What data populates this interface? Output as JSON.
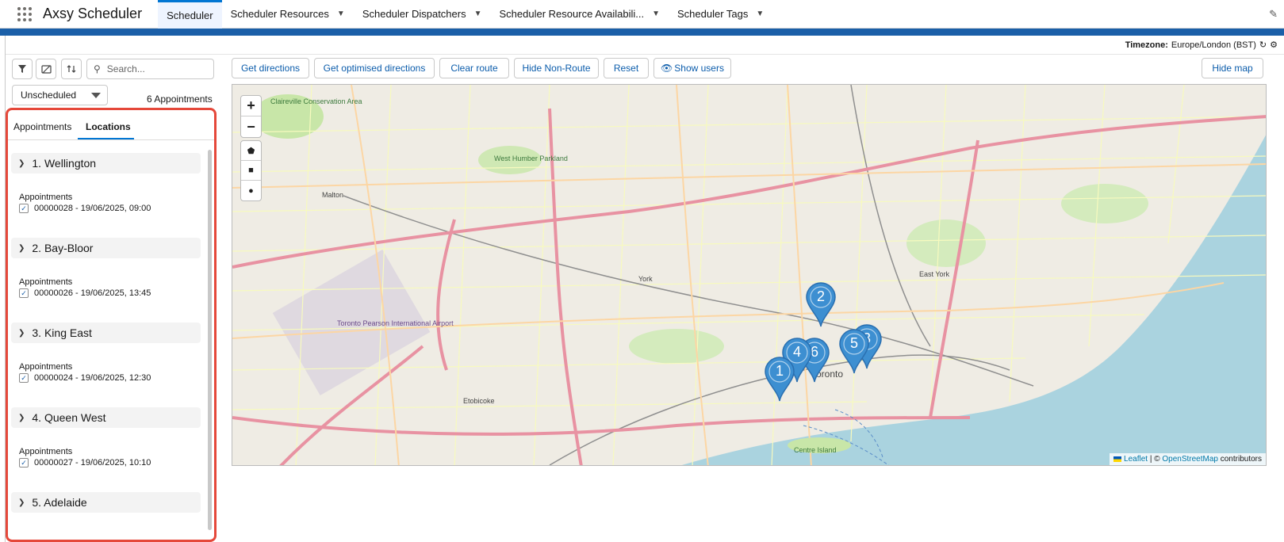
{
  "nav": {
    "app_name": "Axsy Scheduler",
    "tabs": [
      {
        "label": "Scheduler",
        "has_menu": false
      },
      {
        "label": "Scheduler Resources",
        "has_menu": true
      },
      {
        "label": "Scheduler Dispatchers",
        "has_menu": true
      },
      {
        "label": "Scheduler Resource Availabili...",
        "has_menu": true
      },
      {
        "label": "Scheduler Tags",
        "has_menu": true
      }
    ]
  },
  "timezone": {
    "label": "Timezone:",
    "value": "Europe/London (BST)"
  },
  "left": {
    "search_placeholder": "Search...",
    "filter_value": "Unscheduled",
    "count": "6 Appointments",
    "tabs": [
      "Appointments",
      "Locations"
    ],
    "locations": [
      {
        "name": "1. Wellington",
        "appts_label": "Appointments",
        "appt": "00000028 - 19/06/2025, 09:00"
      },
      {
        "name": "2. Bay-Bloor",
        "appts_label": "Appointments",
        "appt": "00000026 - 19/06/2025, 13:45"
      },
      {
        "name": "3. King East",
        "appts_label": "Appointments",
        "appt": "00000024 - 19/06/2025, 12:30"
      },
      {
        "name": "4. Queen West",
        "appts_label": "Appointments",
        "appt": "00000027 - 19/06/2025, 10:10"
      },
      {
        "name": "5. Adelaide"
      }
    ]
  },
  "toolbar": {
    "get_directions": "Get directions",
    "get_optimised": "Get optimised directions",
    "clear_route": "Clear route",
    "hide_non_route": "Hide Non-Route",
    "reset": "Reset",
    "show_users": "Show users",
    "hide_map": "Hide map"
  },
  "map": {
    "zoom_in": "+",
    "zoom_out": "−",
    "labels": {
      "claireville": "Claireville Conservation Area",
      "malton": "Malton",
      "west_humber": "West Humber Parkland",
      "york": "York",
      "east_york": "East York",
      "pearson": "Toronto Pearson International Airport",
      "etobicoke": "Etobicoke",
      "toronto": "Toronto",
      "centre_island": "Centre Island"
    },
    "markers": [
      "1",
      "2",
      "3",
      "4",
      "5",
      "6"
    ],
    "attribution": {
      "leaflet": "Leaflet",
      "osm": "OpenStreetMap",
      "suffix": "contributors"
    }
  },
  "colors": {
    "accent": "#0176d3",
    "panel_border": "#e5483a",
    "marker": "#3d8fd1",
    "banner": "#1b5fa8"
  }
}
